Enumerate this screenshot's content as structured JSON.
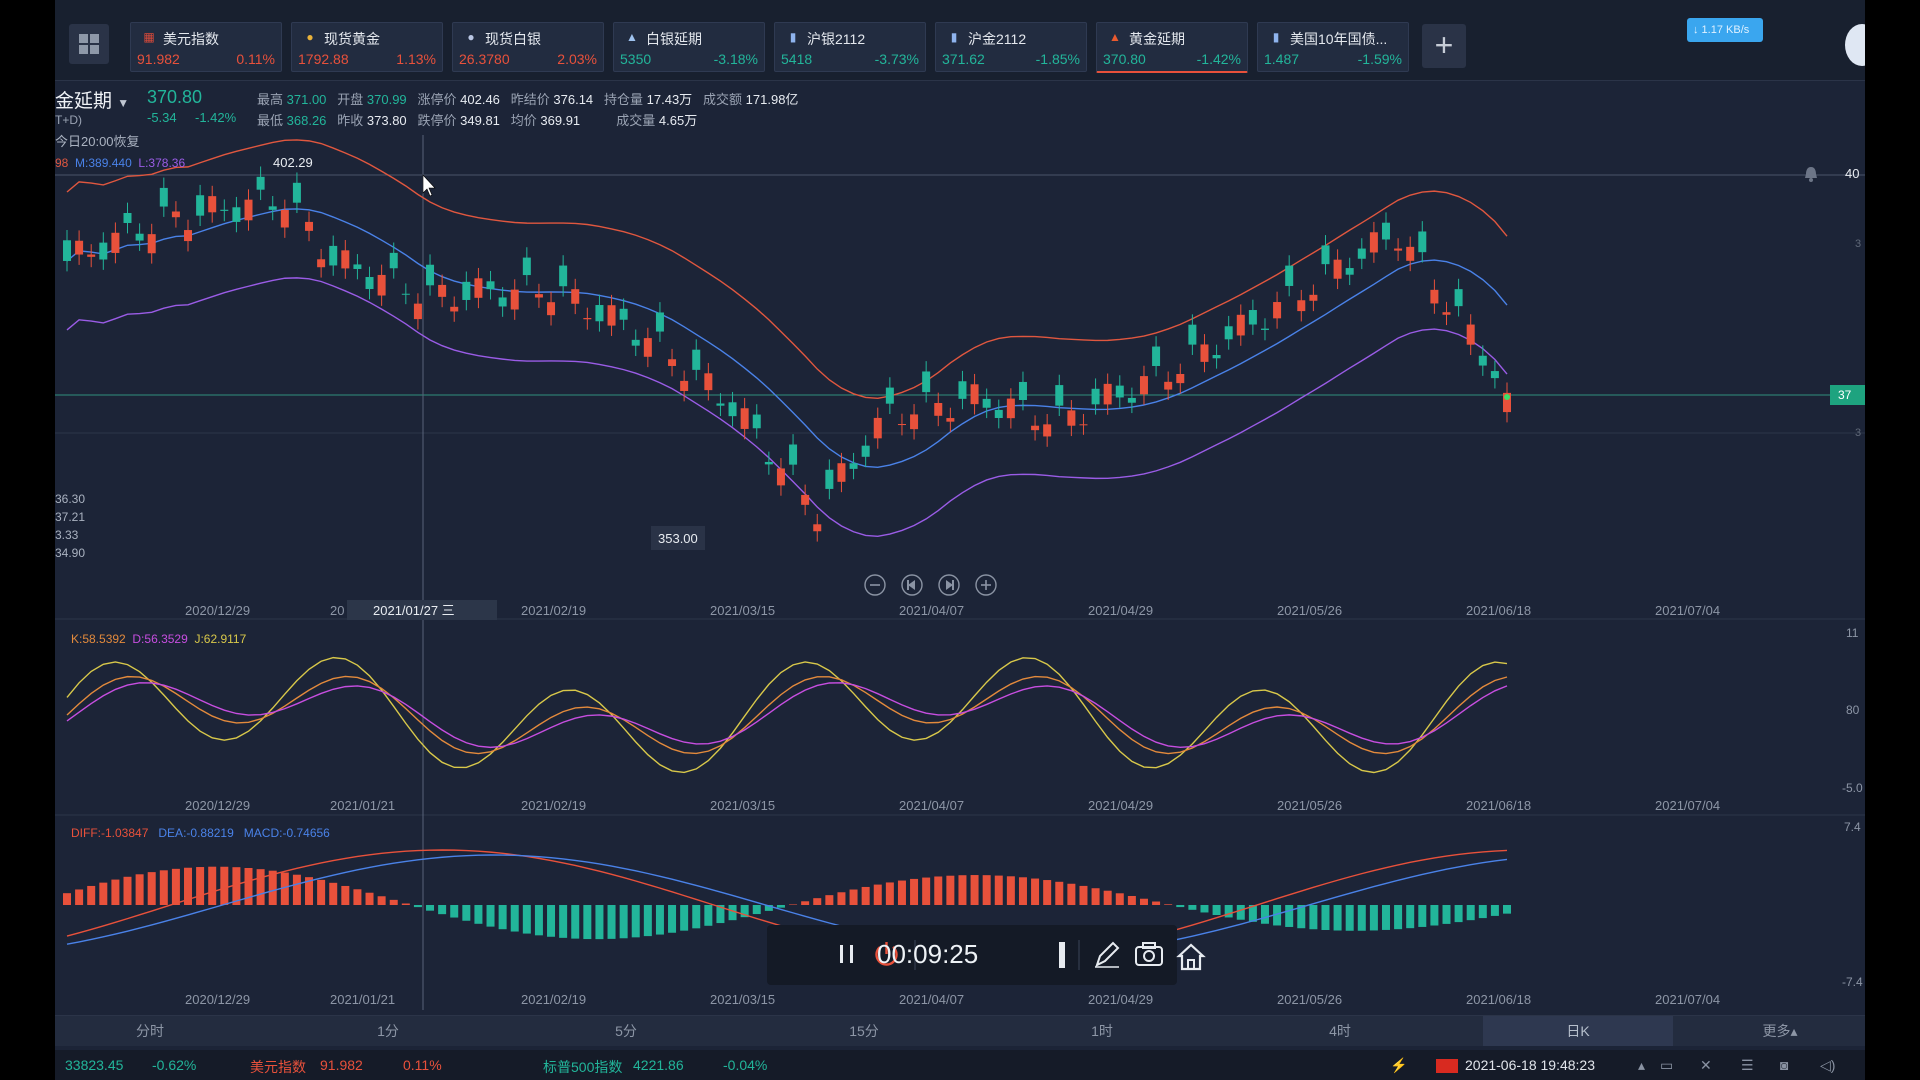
{
  "tickers": [
    {
      "name": "美元指数",
      "price": "91.982",
      "pct": "0.11%",
      "dir": "up",
      "icon": "us-flag-icon"
    },
    {
      "name": "现货黄金",
      "price": "1792.88",
      "pct": "1.13%",
      "dir": "up",
      "icon": "gold-coin-icon"
    },
    {
      "name": "现货白银",
      "price": "26.3780",
      "pct": "2.03%",
      "dir": "up",
      "icon": "silver-coin-icon"
    },
    {
      "name": "白银延期",
      "price": "5350",
      "pct": "-3.18%",
      "dir": "dn",
      "icon": "silver-ingot-icon"
    },
    {
      "name": "沪银2112",
      "price": "5418",
      "pct": "-3.73%",
      "dir": "dn",
      "icon": "bar-chart-icon"
    },
    {
      "name": "沪金2112",
      "price": "371.62",
      "pct": "-1.85%",
      "dir": "dn",
      "icon": "bar-chart-icon"
    },
    {
      "name": "黄金延期",
      "price": "370.80",
      "pct": "-1.42%",
      "dir": "dn",
      "icon": "gold-ingot-icon",
      "active": true
    },
    {
      "name": "美国10年国债...",
      "price": "1.487",
      "pct": "-1.59%",
      "dir": "dn",
      "icon": "bar-chart-icon"
    }
  ],
  "instrument": {
    "title": "金延期",
    "sub": "T+D)",
    "note": "今日20:00恢复",
    "price": "370.80",
    "change": "-5.34",
    "change_pct": "-1.42%"
  },
  "quote_labels": {
    "high": "最高",
    "open": "开盘",
    "limit_up": "涨停价",
    "prev_settle": "昨结价",
    "oi": "持仓量",
    "turnover": "成交额",
    "low": "最低",
    "prev_close": "昨收",
    "limit_down": "跌停价",
    "avg": "均价",
    "volume": "成交量"
  },
  "quote": {
    "high": "371.00",
    "open": "370.99",
    "limit_up": "402.46",
    "prev_settle": "376.14",
    "oi": "17.43万",
    "turnover": "171.98亿",
    "low": "368.26",
    "prev_close": "373.80",
    "limit_down": "349.81",
    "avg": "369.91",
    "volume": "4.65万"
  },
  "boll_legend": {
    "u": "98",
    "m": "M:389.440",
    "l": "L:378.36"
  },
  "left_values": [
    "36.30",
    "37.21",
    "3.33",
    "34.90"
  ],
  "right_labels": {
    "top": "40",
    "price_tag": "37",
    "k_top": "11",
    "k_mid": "80",
    "k_bot": "-5.0",
    "m_top": "7.4",
    "m_bot": "-7.4",
    "r1": "3",
    "r2": "3"
  },
  "kdj_legend": {
    "k": "K:58.5392",
    "d": "D:56.3529",
    "j": "J:62.9117"
  },
  "macd_legend": {
    "diff": "DIFF:-1.03847",
    "dea": "DEA:-0.88219",
    "macd": "MACD:-0.74656"
  },
  "dates": [
    "2020/12/29",
    "2021/01/21",
    "2021/02/19",
    "2021/03/15",
    "2021/04/07",
    "2021/04/29",
    "2021/05/26",
    "2021/06/18",
    "2021/07/04"
  ],
  "main_dates": [
    "2020/12/29",
    "20",
    "2021/02/19",
    "2021/03/15",
    "2021/04/07",
    "2021/04/29",
    "2021/05/26",
    "2021/06/18",
    "2021/07/04"
  ],
  "cursor_date": "2021/01/27 三",
  "high_label": "402.29",
  "low_label": "353.00",
  "periods": [
    "分时",
    "1分",
    "5分",
    "15分",
    "1时",
    "4时",
    "日K",
    "更多▴"
  ],
  "active_period": "日K",
  "status": {
    "idx1_val": "33823.45",
    "idx1_pct": "-0.62%",
    "idx2_name": "美元指数",
    "idx2_val": "91.982",
    "idx2_pct": "0.11%",
    "idx3_name": "标普500指数",
    "idx3_val": "4221.86",
    "idx3_pct": "-0.04%",
    "datetime": "2021-06-18 19:48:23"
  },
  "recording": {
    "time": "00:09:25"
  },
  "net_speed": "↓ 1.17 KB/s",
  "colors": {
    "up": "#e8513b",
    "down": "#22b59a",
    "ma_upper": "#e0573f",
    "ma_mid": "#4a82e8",
    "ma_lower": "#9a5ce6",
    "k": "#e38a3c",
    "d": "#c74ee0",
    "j": "#d8c84a"
  },
  "chart_data": {
    "type": "candlestick",
    "instrument": "黄金延期",
    "period": "日K",
    "x_range": [
      "2020/12/29",
      "2021/07/04"
    ],
    "y_range_approx": [
      350,
      405
    ],
    "high_marker": 402.29,
    "low_marker": 353.0,
    "last_close": 370.8,
    "series": [
      {
        "name": "Bollinger",
        "labels": [
          "98",
          "M:389.440",
          "L:378.36"
        ]
      },
      {
        "name": "KDJ",
        "values": {
          "K": 58.5392,
          "D": 56.3529,
          "J": 62.9117
        }
      },
      {
        "name": "MACD",
        "values": {
          "DIFF": -1.03847,
          "DEA": -0.88219,
          "MACD": -0.74656
        }
      }
    ]
  }
}
